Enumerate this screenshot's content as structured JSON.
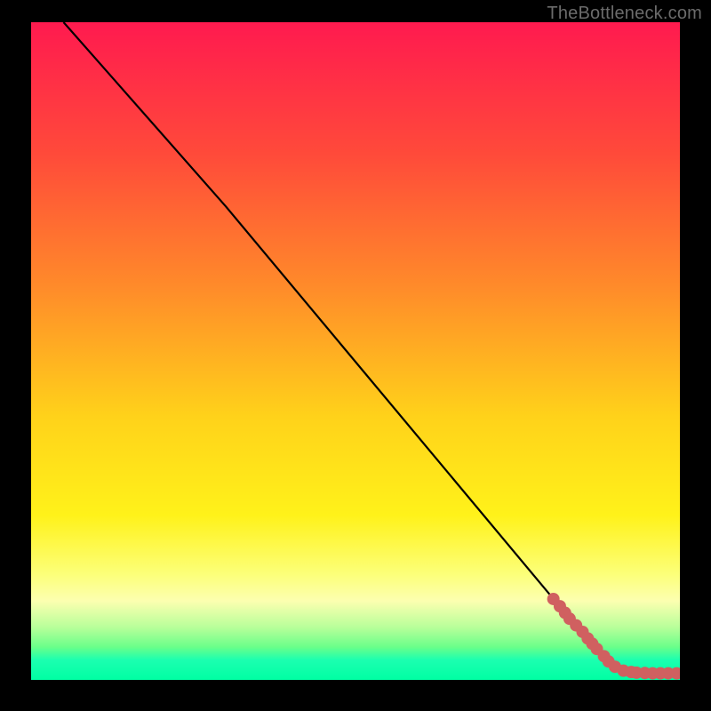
{
  "watermark": "TheBottleneck.com",
  "chart_data": {
    "type": "line",
    "title": "",
    "xlabel": "",
    "ylabel": "",
    "xlim": [
      0,
      100
    ],
    "ylim": [
      0,
      100
    ],
    "grid": false,
    "legend": false,
    "gradient_stops": [
      {
        "offset": 0.0,
        "color": "#ff1a4f"
      },
      {
        "offset": 0.2,
        "color": "#ff4a3a"
      },
      {
        "offset": 0.4,
        "color": "#ff8a2a"
      },
      {
        "offset": 0.6,
        "color": "#ffd21a"
      },
      {
        "offset": 0.75,
        "color": "#fff21a"
      },
      {
        "offset": 0.84,
        "color": "#fcff7a"
      },
      {
        "offset": 0.88,
        "color": "#fcffb0"
      },
      {
        "offset": 0.92,
        "color": "#b8ff9a"
      },
      {
        "offset": 0.95,
        "color": "#6aff8a"
      },
      {
        "offset": 0.97,
        "color": "#1bffb0"
      },
      {
        "offset": 1.0,
        "color": "#00ffa3"
      }
    ],
    "series": [
      {
        "name": "curve",
        "type": "line",
        "color": "#000000",
        "x": [
          5,
          30,
          85,
          90,
          100
        ],
        "y": [
          100,
          72,
          7,
          2,
          1
        ]
      },
      {
        "name": "points",
        "type": "scatter",
        "color": "#d06060",
        "x": [
          80.5,
          81.5,
          82.3,
          83.0,
          84.0,
          85.0,
          85.8,
          86.5,
          87.2,
          88.3,
          89.0,
          90.0,
          91.3,
          92.5,
          93.3,
          94.6,
          95.8,
          97.0,
          98.2,
          99.5
        ],
        "y": [
          12.3,
          11.2,
          10.2,
          9.3,
          8.3,
          7.3,
          6.3,
          5.5,
          4.7,
          3.6,
          2.8,
          2.0,
          1.4,
          1.2,
          1.1,
          1.05,
          1.0,
          1.0,
          1.0,
          1.0
        ]
      }
    ]
  }
}
